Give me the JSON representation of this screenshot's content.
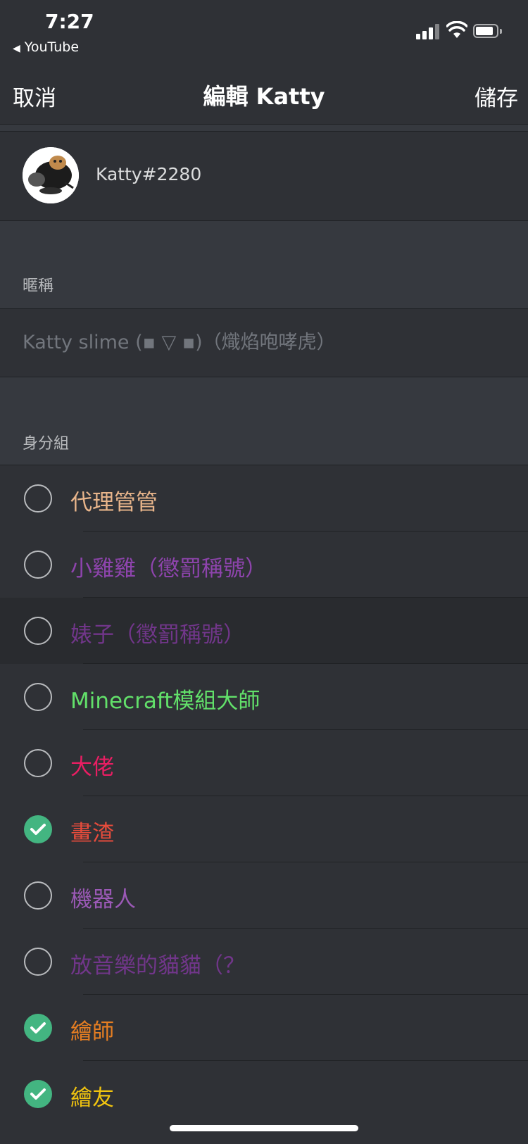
{
  "status_bar": {
    "time": "7:27",
    "back_app": "YouTube",
    "back_icon": "back-triangle-icon"
  },
  "nav": {
    "cancel_label": "取消",
    "title": "編輯 Katty",
    "save_label": "儲存"
  },
  "profile": {
    "username": "Katty#2280",
    "avatar_icon": "user-avatar"
  },
  "nickname": {
    "section_label": "暱稱",
    "placeholder": "Katty slime (▪ ▽ ▪)（熾焰咆哮虎）"
  },
  "roles": {
    "section_label": "身分組",
    "items": [
      {
        "name": "代理管管",
        "checked": false,
        "color": "#e8b58b"
      },
      {
        "name": "小雞雞（懲罰稱號）",
        "checked": false,
        "color": "#8e44ad"
      },
      {
        "name": "婊子（懲罰稱號）",
        "checked": false,
        "color": "#71368a"
      },
      {
        "name": "Minecraft模組大師",
        "checked": false,
        "color": "#62e06a"
      },
      {
        "name": "大佬",
        "checked": false,
        "color": "#e91e63"
      },
      {
        "name": "畫渣",
        "checked": true,
        "color": "#e74c3c"
      },
      {
        "name": "機器人",
        "checked": false,
        "color": "#9b59b6"
      },
      {
        "name": "放音樂的貓貓（？",
        "checked": false,
        "color": "#71368a"
      },
      {
        "name": "繪師",
        "checked": true,
        "color": "#e67e22"
      },
      {
        "name": "繪友",
        "checked": true,
        "color": "#f1c40f"
      }
    ]
  },
  "colors": {
    "check_green": "#43b581",
    "background": "#36393f",
    "row_background": "#2f3136"
  }
}
